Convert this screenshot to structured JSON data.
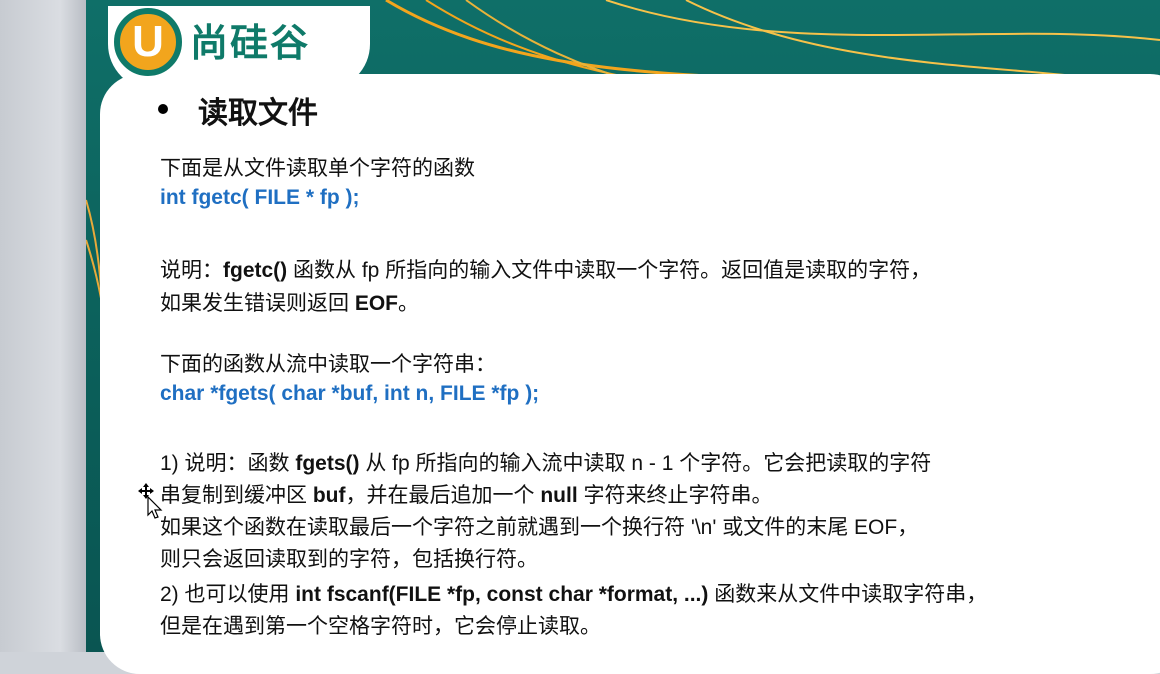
{
  "logo": {
    "letter": "U",
    "text": "尚硅谷"
  },
  "heading": "读取文件",
  "lines": {
    "l1": "下面是从文件读取单个字符的函数",
    "l2": "int fgetc( FILE * fp );",
    "l3_pre": "说明：",
    "l3_code": "fgetc()",
    "l3_post": " 函数从 fp 所指向的输入文件中读取一个字符。返回值是读取的字符，",
    "l4_pre": "如果发生错误则返回 ",
    "l4_code": "EOF",
    "l4_post": "。",
    "l5": "下面的函数从流中读取一个字符串：",
    "l6": "char *fgets( char *buf, int n, FILE *fp );",
    "l7_pre": "1) 说明：函数 ",
    "l7_code": "fgets()",
    "l7_post": " 从 fp 所指向的输入流中读取 n - 1 个字符。它会把读取的字符",
    "l8_pre": "串复制到缓冲区 ",
    "l8_code1": "buf",
    "l8_mid": "，并在最后追加一个 ",
    "l8_code2": "null",
    "l8_post": " 字符来终止字符串。",
    "l9": "如果这个函数在读取最后一个字符之前就遇到一个换行符 '\\n' 或文件的末尾 EOF，",
    "l10": "则只会返回读取到的字符，包括换行符。",
    "l11_pre": "2) 也可以使用 ",
    "l11_code": "int fscanf(FILE *fp, const char *format, ...)",
    "l11_post": " 函数来从文件中读取字符串，",
    "l12": "但是在遇到第一个空格字符时，它会停止读取。"
  },
  "colors": {
    "code_blue": "#1f6fc2",
    "teal": "#0f6f68",
    "orange": "#f2a51d"
  }
}
